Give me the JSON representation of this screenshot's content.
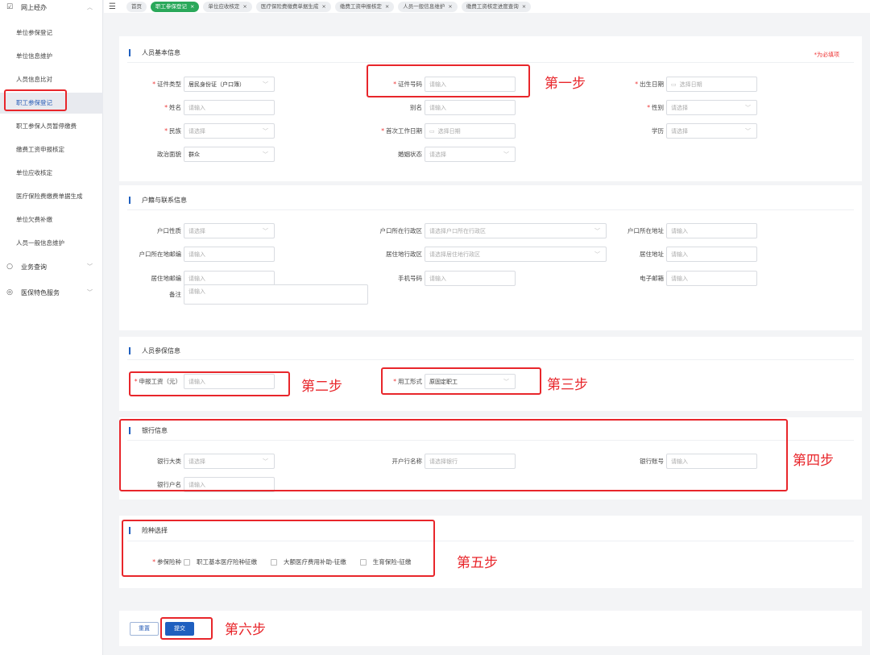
{
  "topbar": {
    "tabs": [
      {
        "label": "首页",
        "closable": false
      },
      {
        "label": "职工参保登记",
        "closable": true,
        "active": true
      },
      {
        "label": "单位应收核定",
        "closable": true
      },
      {
        "label": "医疗保险费缴费单据生成",
        "closable": true
      },
      {
        "label": "缴费工资申报核定",
        "closable": true
      },
      {
        "label": "人员一般信息维护",
        "closable": true
      },
      {
        "label": "缴费工资核定进度查询",
        "closable": true
      }
    ],
    "close_glyph": "×"
  },
  "sidebar": {
    "group_online": "网上经办",
    "items": [
      "单位参保登记",
      "单位信息维护",
      "人员信息比对",
      "职工参保登记",
      "职工参保人员暂停缴费",
      "缴费工资申报核定",
      "单位应收核定",
      "医疗保险费缴费单据生成",
      "单位欠费补缴",
      "人员一般信息维护"
    ],
    "active_index": 3,
    "group_query": "业务查询",
    "group_special": "医保特色服务"
  },
  "required_note": "为必填项",
  "sections": [
    {
      "title": "人员基本信息",
      "fields": [
        {
          "label": "证件类型",
          "required": true,
          "type": "select",
          "text": "居民身份证（户口簿）",
          "filled": true
        },
        {
          "label": "证件号码",
          "required": true,
          "type": "input",
          "text": "请输入"
        },
        {
          "label": "出生日期",
          "required": true,
          "type": "date",
          "text": "选择日期"
        },
        {
          "label": "姓名",
          "required": true,
          "type": "input",
          "text": "请输入"
        },
        {
          "label": "别名",
          "required": false,
          "type": "input",
          "text": "请输入"
        },
        {
          "label": "性别",
          "required": true,
          "type": "select",
          "text": "请选择"
        },
        {
          "label": "民族",
          "required": true,
          "type": "select",
          "text": "请选择"
        },
        {
          "label": "首次工作日期",
          "required": true,
          "type": "date",
          "text": "选择日期"
        },
        {
          "label": "学历",
          "required": false,
          "type": "select",
          "text": "请选择"
        },
        {
          "label": "政治面貌",
          "required": false,
          "type": "select",
          "text": "群众",
          "filled": true
        },
        {
          "label": "婚姻状态",
          "required": false,
          "type": "select",
          "text": "请选择"
        }
      ]
    },
    {
      "title": "户籍与联系信息",
      "fields": [
        {
          "label": "户口性质",
          "required": false,
          "type": "select",
          "text": "请选择"
        },
        {
          "label": "户口所在行政区",
          "required": false,
          "type": "cascader",
          "text": "请选择户口所在行政区"
        },
        {
          "label": "户口所在地址",
          "required": false,
          "type": "input",
          "text": "请输入"
        },
        {
          "label": "户口所在地邮编",
          "required": false,
          "type": "input",
          "text": "请输入"
        },
        {
          "label": "居住地行政区",
          "required": false,
          "type": "cascader",
          "text": "请选择居住地行政区"
        },
        {
          "label": "居住地址",
          "required": false,
          "type": "input",
          "text": "请输入"
        },
        {
          "label": "居住地邮编",
          "required": false,
          "type": "input",
          "text": "请输入"
        },
        {
          "label": "手机号码",
          "required": false,
          "type": "input",
          "text": "请输入"
        },
        {
          "label": "电子邮箱",
          "required": false,
          "type": "input",
          "text": "请输入"
        },
        {
          "label": "备注",
          "required": false,
          "type": "textarea",
          "text": "请输入"
        }
      ]
    },
    {
      "title": "人员参保信息",
      "fields": [
        {
          "label": "申报工资（元）",
          "required": true,
          "type": "input",
          "text": "请输入"
        },
        {
          "label": "用工形式",
          "required": true,
          "type": "select",
          "text": "原固定职工",
          "filled": true
        }
      ]
    },
    {
      "title": "银行信息",
      "fields": [
        {
          "label": "银行大类",
          "required": false,
          "type": "select",
          "text": "请选择"
        },
        {
          "label": "开户行名称",
          "required": false,
          "type": "input",
          "text": "请选择银行"
        },
        {
          "label": "银行账号",
          "required": false,
          "type": "input",
          "text": "请输入"
        },
        {
          "label": "银行户名",
          "required": false,
          "type": "input",
          "text": "请输入"
        }
      ]
    },
    {
      "title": "险种选择",
      "insurance_label": "参保险种",
      "options": [
        "职工基本医疗险种征缴",
        "大额医疗费用补助-征缴",
        "生育保险-征缴"
      ]
    }
  ],
  "buttons": {
    "reset": "重置",
    "submit": "提交"
  },
  "annotations": [
    "第一步",
    "第二步",
    "第三步",
    "第四步",
    "第五步",
    "第六步"
  ],
  "colors": {
    "accent": "#1f5fbf",
    "active_tab": "#2aa85a",
    "annotation": "#e8262b"
  }
}
